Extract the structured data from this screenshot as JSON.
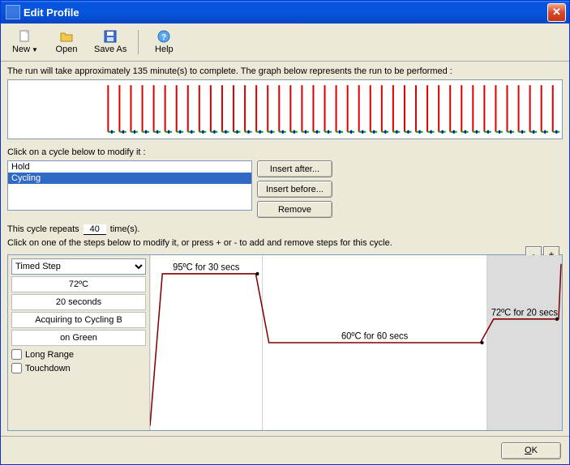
{
  "title": "Edit Profile",
  "toolbar": {
    "new": "New",
    "open": "Open",
    "saveas": "Save As",
    "help": "Help"
  },
  "summary": "The run will take approximately 135 minute(s) to complete. The graph below represents the run to be performed :",
  "cycle_instr": "Click on a cycle below to modify it :",
  "cycles": {
    "items": [
      {
        "label": "Hold",
        "selected": false
      },
      {
        "label": "Cycling",
        "selected": true
      }
    ]
  },
  "buttons": {
    "insert_after": "Insert after...",
    "insert_before": "Insert before...",
    "remove": "Remove",
    "ok": "OK",
    "plus": "+",
    "minus": "-"
  },
  "repeats": {
    "prefix": "This cycle repeats",
    "value": "40",
    "suffix": "time(s)."
  },
  "step_instr": "Click on one of the steps below to modify it, or press + or - to add and remove steps for this cycle.",
  "step_panel": {
    "type_selected": "Timed Step",
    "temp": "72ºC",
    "duration": "20 seconds",
    "acquire": "Acquiring to Cycling B",
    "channel": "on Green",
    "long_range": "Long Range",
    "touchdown": "Touchdown",
    "long_range_checked": false,
    "touchdown_checked": false
  },
  "chart_data": {
    "type": "line",
    "title": "",
    "xlabel": "",
    "ylabel": "",
    "steps": [
      {
        "temp_c": 95,
        "duration_s": 30,
        "label": "95ºC for 30 secs"
      },
      {
        "temp_c": 60,
        "duration_s": 60,
        "label": "60ºC for 60 secs"
      },
      {
        "temp_c": 72,
        "duration_s": 20,
        "label": "72ºC for 20 secs"
      }
    ],
    "selected_step_index": 2,
    "ylim": [
      20,
      100
    ]
  },
  "overview": {
    "hold_segments": 1,
    "cycle_repeats": 40
  }
}
